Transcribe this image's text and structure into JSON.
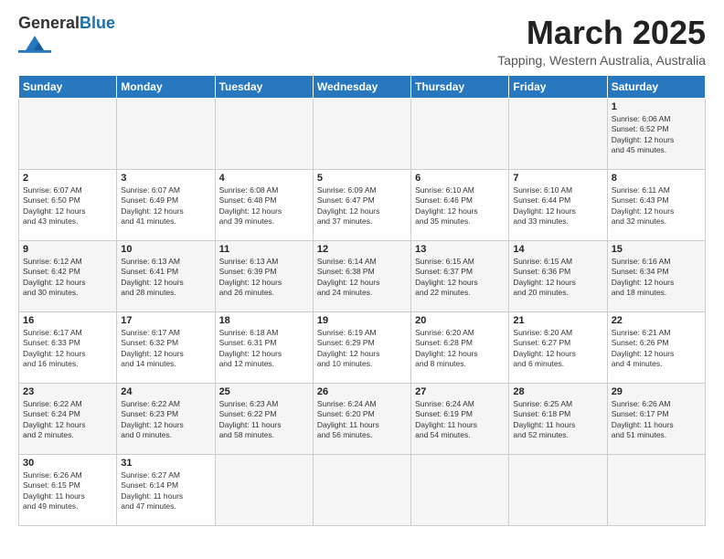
{
  "header": {
    "logo_general": "General",
    "logo_blue": "Blue",
    "month_title": "March 2025",
    "subtitle": "Tapping, Western Australia, Australia"
  },
  "weekdays": [
    "Sunday",
    "Monday",
    "Tuesday",
    "Wednesday",
    "Thursday",
    "Friday",
    "Saturday"
  ],
  "weeks": [
    [
      {
        "day": "",
        "info": ""
      },
      {
        "day": "",
        "info": ""
      },
      {
        "day": "",
        "info": ""
      },
      {
        "day": "",
        "info": ""
      },
      {
        "day": "",
        "info": ""
      },
      {
        "day": "",
        "info": ""
      },
      {
        "day": "1",
        "info": "Sunrise: 6:06 AM\nSunset: 6:52 PM\nDaylight: 12 hours\nand 45 minutes."
      }
    ],
    [
      {
        "day": "2",
        "info": "Sunrise: 6:07 AM\nSunset: 6:50 PM\nDaylight: 12 hours\nand 43 minutes."
      },
      {
        "day": "3",
        "info": "Sunrise: 6:07 AM\nSunset: 6:49 PM\nDaylight: 12 hours\nand 41 minutes."
      },
      {
        "day": "4",
        "info": "Sunrise: 6:08 AM\nSunset: 6:48 PM\nDaylight: 12 hours\nand 39 minutes."
      },
      {
        "day": "5",
        "info": "Sunrise: 6:09 AM\nSunset: 6:47 PM\nDaylight: 12 hours\nand 37 minutes."
      },
      {
        "day": "6",
        "info": "Sunrise: 6:10 AM\nSunset: 6:46 PM\nDaylight: 12 hours\nand 35 minutes."
      },
      {
        "day": "7",
        "info": "Sunrise: 6:10 AM\nSunset: 6:44 PM\nDaylight: 12 hours\nand 33 minutes."
      },
      {
        "day": "8",
        "info": "Sunrise: 6:11 AM\nSunset: 6:43 PM\nDaylight: 12 hours\nand 32 minutes."
      }
    ],
    [
      {
        "day": "9",
        "info": "Sunrise: 6:12 AM\nSunset: 6:42 PM\nDaylight: 12 hours\nand 30 minutes."
      },
      {
        "day": "10",
        "info": "Sunrise: 6:13 AM\nSunset: 6:41 PM\nDaylight: 12 hours\nand 28 minutes."
      },
      {
        "day": "11",
        "info": "Sunrise: 6:13 AM\nSunset: 6:39 PM\nDaylight: 12 hours\nand 26 minutes."
      },
      {
        "day": "12",
        "info": "Sunrise: 6:14 AM\nSunset: 6:38 PM\nDaylight: 12 hours\nand 24 minutes."
      },
      {
        "day": "13",
        "info": "Sunrise: 6:15 AM\nSunset: 6:37 PM\nDaylight: 12 hours\nand 22 minutes."
      },
      {
        "day": "14",
        "info": "Sunrise: 6:15 AM\nSunset: 6:36 PM\nDaylight: 12 hours\nand 20 minutes."
      },
      {
        "day": "15",
        "info": "Sunrise: 6:16 AM\nSunset: 6:34 PM\nDaylight: 12 hours\nand 18 minutes."
      }
    ],
    [
      {
        "day": "16",
        "info": "Sunrise: 6:17 AM\nSunset: 6:33 PM\nDaylight: 12 hours\nand 16 minutes."
      },
      {
        "day": "17",
        "info": "Sunrise: 6:17 AM\nSunset: 6:32 PM\nDaylight: 12 hours\nand 14 minutes."
      },
      {
        "day": "18",
        "info": "Sunrise: 6:18 AM\nSunset: 6:31 PM\nDaylight: 12 hours\nand 12 minutes."
      },
      {
        "day": "19",
        "info": "Sunrise: 6:19 AM\nSunset: 6:29 PM\nDaylight: 12 hours\nand 10 minutes."
      },
      {
        "day": "20",
        "info": "Sunrise: 6:20 AM\nSunset: 6:28 PM\nDaylight: 12 hours\nand 8 minutes."
      },
      {
        "day": "21",
        "info": "Sunrise: 6:20 AM\nSunset: 6:27 PM\nDaylight: 12 hours\nand 6 minutes."
      },
      {
        "day": "22",
        "info": "Sunrise: 6:21 AM\nSunset: 6:26 PM\nDaylight: 12 hours\nand 4 minutes."
      }
    ],
    [
      {
        "day": "23",
        "info": "Sunrise: 6:22 AM\nSunset: 6:24 PM\nDaylight: 12 hours\nand 2 minutes."
      },
      {
        "day": "24",
        "info": "Sunrise: 6:22 AM\nSunset: 6:23 PM\nDaylight: 12 hours\nand 0 minutes."
      },
      {
        "day": "25",
        "info": "Sunrise: 6:23 AM\nSunset: 6:22 PM\nDaylight: 11 hours\nand 58 minutes."
      },
      {
        "day": "26",
        "info": "Sunrise: 6:24 AM\nSunset: 6:20 PM\nDaylight: 11 hours\nand 56 minutes."
      },
      {
        "day": "27",
        "info": "Sunrise: 6:24 AM\nSunset: 6:19 PM\nDaylight: 11 hours\nand 54 minutes."
      },
      {
        "day": "28",
        "info": "Sunrise: 6:25 AM\nSunset: 6:18 PM\nDaylight: 11 hours\nand 52 minutes."
      },
      {
        "day": "29",
        "info": "Sunrise: 6:26 AM\nSunset: 6:17 PM\nDaylight: 11 hours\nand 51 minutes."
      }
    ],
    [
      {
        "day": "30",
        "info": "Sunrise: 6:26 AM\nSunset: 6:15 PM\nDaylight: 11 hours\nand 49 minutes."
      },
      {
        "day": "31",
        "info": "Sunrise: 6:27 AM\nSunset: 6:14 PM\nDaylight: 11 hours\nand 47 minutes."
      },
      {
        "day": "",
        "info": ""
      },
      {
        "day": "",
        "info": ""
      },
      {
        "day": "",
        "info": ""
      },
      {
        "day": "",
        "info": ""
      },
      {
        "day": "",
        "info": ""
      }
    ]
  ]
}
